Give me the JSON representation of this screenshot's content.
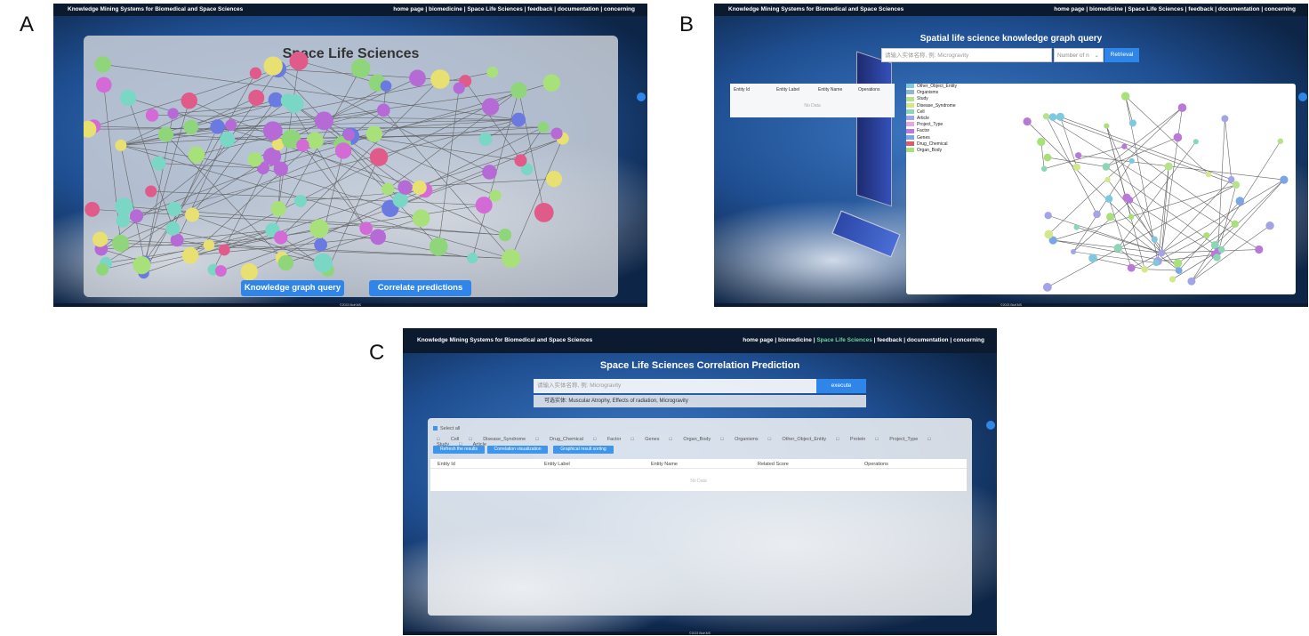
{
  "panel_labels": {
    "a": "A",
    "b": "B",
    "c": "C"
  },
  "common": {
    "brand": "Knowledge Mining Systems for Biomedical and Space Sciences",
    "nav": [
      "home page",
      "biomedicine",
      "Space Life Sciences",
      "feedback",
      "documentation",
      "concerning"
    ],
    "footer": "©2023 BioKMS"
  },
  "screen_a": {
    "title": "Space Life Sciences",
    "buttons": {
      "kg_query": "Knowledge graph query",
      "correlate": "Correlate predictions"
    }
  },
  "screen_b": {
    "title": "Spatial life science knowledge graph query",
    "search_placeholder": "请输入实体名称, 例: Microgravity",
    "select_value": "Number of n",
    "retrieval_button": "Retrieval",
    "table_headers": [
      "Entity Id",
      "Entity Label",
      "Entity Name",
      "Operations"
    ],
    "no_data": "No Data",
    "legend": [
      {
        "label": "Other_Object_Entity",
        "color": "#7ec9e0"
      },
      {
        "label": "Organisms",
        "color": "#8fb3d9"
      },
      {
        "label": "Study",
        "color": "#b6e28a"
      },
      {
        "label": "Disease_Syndrome",
        "color": "#d3e88b"
      },
      {
        "label": "Cell",
        "color": "#8ad6b5"
      },
      {
        "label": "Article",
        "color": "#a3a3e8"
      },
      {
        "label": "Project_Type",
        "color": "#e9a6d6"
      },
      {
        "label": "Factor",
        "color": "#b77ad6"
      },
      {
        "label": "Genes",
        "color": "#7aa6e8"
      },
      {
        "label": "Drug_Chemical",
        "color": "#e05a6a"
      },
      {
        "label": "Organ_Body",
        "color": "#a8e07a"
      }
    ]
  },
  "screen_c": {
    "title": "Space Life Sciences Correlation Prediction",
    "input_placeholder": "请输入实体名称, 例: Microgravity",
    "execute": "execute",
    "hint": "可选实体: Muscular Atrophy, Effects of radiation, Microgravity",
    "select_all": "Select all",
    "checkboxes": [
      "Cell",
      "Disease_Syndrome",
      "Drug_Chemical",
      "Factor",
      "Genes",
      "Organ_Body",
      "Organisms",
      "Other_Object_Entity",
      "Protein",
      "Project_Type",
      "Study",
      "Article"
    ],
    "buttons": [
      "Refresh the results",
      "Correlation visualization",
      "Graphical result sorting"
    ],
    "table_headers": [
      "Entity Id",
      "Entity Label",
      "Entity Name",
      "Related Score",
      "Operations"
    ],
    "no_data": "No Data"
  }
}
